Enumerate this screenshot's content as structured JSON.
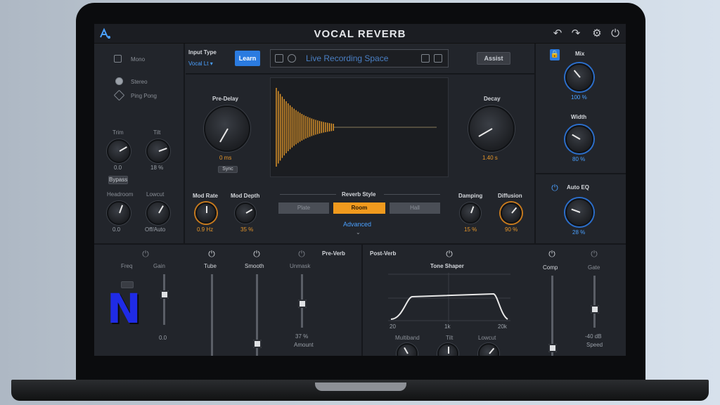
{
  "header": {
    "title": "VOCAL REVERB",
    "icons": [
      "logo-icon",
      "undo-icon",
      "redo-icon",
      "settings-icon",
      "power-icon"
    ]
  },
  "left_panel": {
    "mono_label": "Mono",
    "stereo_label": "Stereo",
    "pingpong_label": "Ping Pong",
    "trim_label": "Trim",
    "tilt_label": "Tilt",
    "trim_value": "0.0",
    "tilt_value": "18 %",
    "bypass_btn": "Bypass",
    "headroom_label": "Headroom",
    "lowcut_label": "Lowcut",
    "headroom_value": "0.0",
    "lowcut_value": "Off/Auto"
  },
  "top": {
    "input_type_label": "Input Type",
    "input_type_value": "Vocal Lt ▾",
    "learn_button": "Learn",
    "preset_name": "Live Recording Space",
    "assist_button": "Assist"
  },
  "center": {
    "predelay_label": "Pre-Delay",
    "predelay_value": "0 ms",
    "sync_btn": "Sync",
    "decay_label": "Decay",
    "decay_value": "1.40 s",
    "mod_rate_label": "Mod Rate",
    "mod_rate_value": "0.9 Hz",
    "mod_depth_label": "Mod Depth",
    "mod_depth_value": "35 %",
    "reverb_style_label": "Reverb Style",
    "styles": [
      "Plate",
      "Room",
      "Hall"
    ],
    "advanced_link": "Advanced",
    "damping_label": "Damping",
    "damping_value": "15 %",
    "diffusion_label": "Diffusion",
    "diffusion_value": "90 %"
  },
  "right_panel": {
    "mix_label": "Mix",
    "mix_value": "100 %",
    "width_label": "Width",
    "width_value": "80 %",
    "autoeq_label": "Auto EQ",
    "autoeq_value": "28 %"
  },
  "bottom": {
    "prewash_label": "Pre-Verb",
    "freq_label": "Freq",
    "gain_label": "Gain",
    "tube_label": "Tube",
    "tube_pct": 0,
    "smooth_label": "Smooth",
    "smooth_pct": 15,
    "unmask_label": "Unmask",
    "unmask_value": "37 %",
    "unmask_sub": "Amount",
    "unmask_pct": 45,
    "gain_pct": 60,
    "gain_value": "0.0",
    "reverb_section": "Post-Verb",
    "tone_shaper_label": "Tone Shaper",
    "eq_low": "20",
    "eq_mid": "1k",
    "eq_high": "20k",
    "multiband_label": "Multiband",
    "tilt_label": "Tilt",
    "lowcut_label": "Lowcut",
    "comp_label": "Comp",
    "comp_pct": 10,
    "gate_label": "Gate",
    "gate_pct": 35,
    "gate_value": "-40 dB",
    "gate_sub": "Speed"
  },
  "colors": {
    "accent_orange": "#f09a1e",
    "accent_blue": "#2b7be0",
    "panel": "#25282e",
    "waveform": "#e79a2a"
  }
}
